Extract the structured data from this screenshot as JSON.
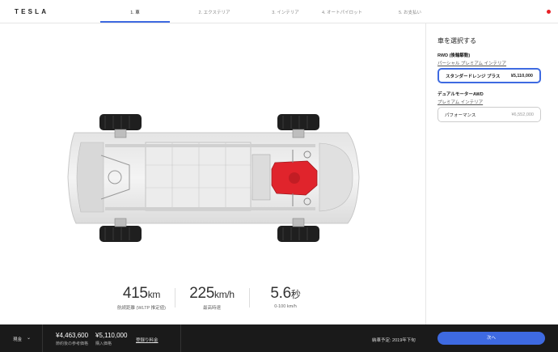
{
  "brand": "TESLA",
  "nav": {
    "steps": [
      "1. 車",
      "2. エクステリア",
      "3. インテリア",
      "4. オートパイロット",
      "5. お支払い"
    ]
  },
  "specs": [
    {
      "value": "415",
      "unit": "km",
      "label": "航続距離 (WLTP 推定値)"
    },
    {
      "value": "225",
      "unit": "km/h",
      "label": "最高時速"
    },
    {
      "value": "5.6",
      "unit": "秒",
      "label": "0-100 km/h"
    }
  ],
  "panel": {
    "title": "車を選択する",
    "groups": [
      {
        "title": "RWD (後輪駆動)",
        "link": "パーシャル プレミアム インテリア",
        "option": {
          "name": "スタンダードレンジ プラス",
          "price": "¥5,110,000",
          "selected": true
        }
      },
      {
        "title": "デュアルモーターAWD",
        "link": "プレミアム インテリア",
        "option": {
          "name": "パフォーマンス",
          "price": "¥6,552,000",
          "selected": false
        }
      }
    ]
  },
  "bottom": {
    "payment": "現金",
    "price1": "¥4,463,600",
    "price1_label": "節約後の参考価格",
    "price2": "¥5,110,000",
    "price2_label": "購入価格",
    "fee_link": "登録り料金",
    "delivery": "納車予定: 2019年下旬",
    "next": "次へ"
  },
  "colors": {
    "accent": "#3e6ae1",
    "motor": "#e0242c",
    "bar": "#1a1a1a"
  }
}
